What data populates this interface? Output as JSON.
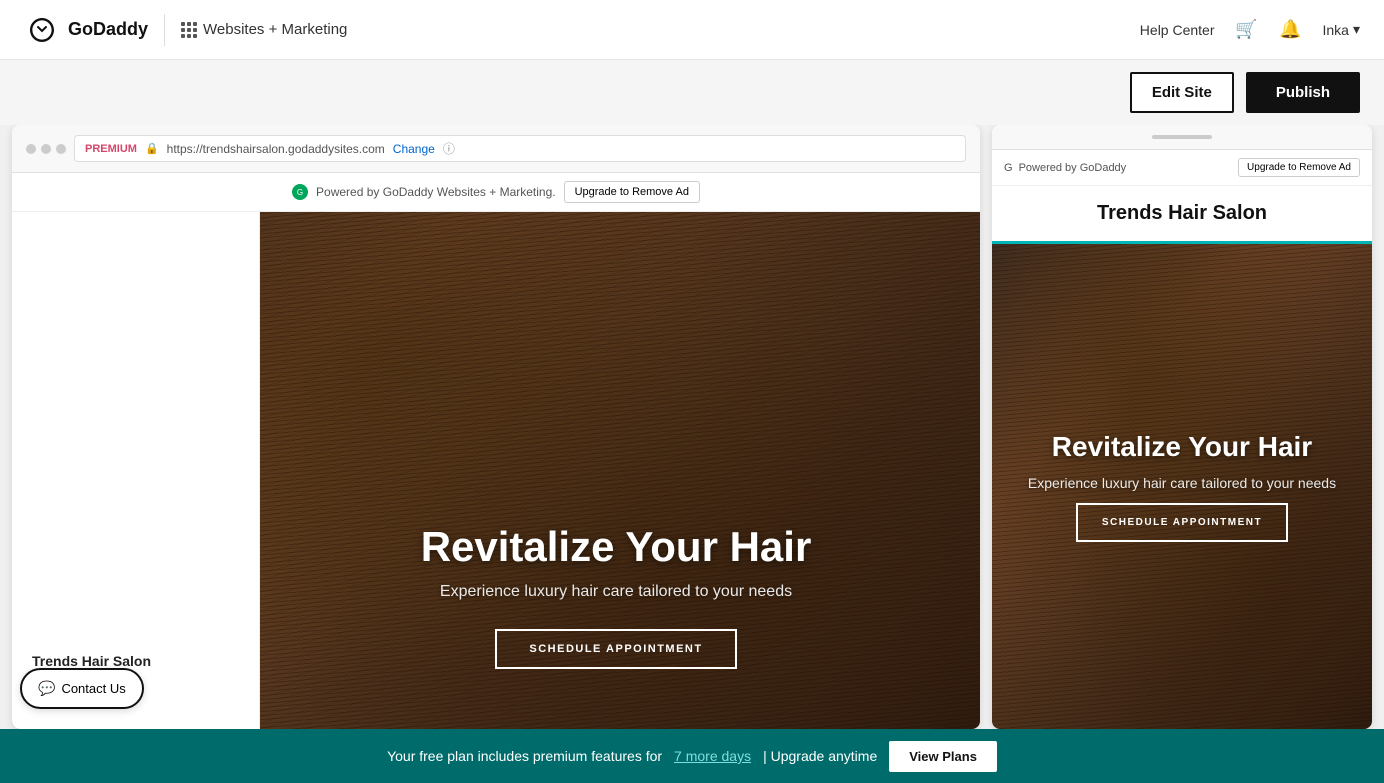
{
  "nav": {
    "logo_text": "GoDaddy",
    "app_name": "Websites + Marketing",
    "help_center": "Help Center",
    "user_name": "Inka",
    "cart_icon": "cart-icon",
    "bell_icon": "bell-icon",
    "chevron_icon": "chevron-down-icon"
  },
  "toolbar": {
    "edit_site_label": "Edit Site",
    "publish_label": "Publish"
  },
  "browser": {
    "premium_badge": "PREMIUM",
    "url": "https://trendshairsalon.godaddysites.com",
    "change_link": "Change",
    "info_icon": "ⓘ",
    "ad_text": "Powered by GoDaddy Websites + Marketing.",
    "upgrade_btn": "Upgrade to Remove Ad"
  },
  "site": {
    "title": "Trends Hair Salon",
    "hero_title": "Revitalize Your Hair",
    "hero_subtitle": "Experience luxury hair care tailored to your needs",
    "schedule_btn": "SCHEDULE APPOINTMENT",
    "contact_us": "Contact Us",
    "salon_name_sidebar": "Trends Hair Salon"
  },
  "mobile": {
    "ad_text": "Powered by GoDaddy",
    "upgrade_btn": "Upgrade to Remove Ad",
    "site_title": "Trends Hair Salon",
    "hero_title": "Revitalize Your Hair",
    "hero_subtitle": "Experience luxury hair care tailored to your needs",
    "schedule_btn": "SCHEDULE APPOINTMENT"
  },
  "bottom_banner": {
    "text_before": "Your free plan includes premium features for",
    "days_link": "7 more days",
    "text_after": "| Upgrade anytime",
    "view_plans_btn": "View Plans"
  }
}
